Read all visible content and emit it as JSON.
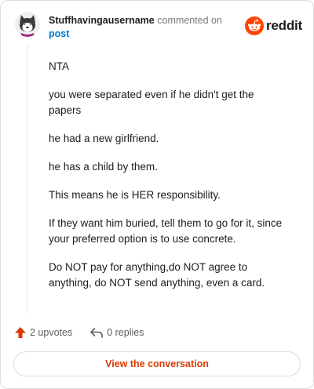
{
  "header": {
    "username": "Stuffhavingausername",
    "action_text": "commented on",
    "post_link": "post",
    "brand": "reddit"
  },
  "comment": {
    "paragraphs": [
      "NTA",
      "you were separated even if he didn't get the papers",
      "he had a new girlfriend.",
      "he has a child by them.",
      "This means he is HER responsibility.",
      "If they want him buried, tell them to go for it, since your preferred option is to use concrete.",
      "Do NOT pay for anything,do NOT agree to anything, do NOT send anything, even a card."
    ]
  },
  "actions": {
    "upvotes": "2 upvotes",
    "replies": "0 replies"
  },
  "footer": {
    "view_button": "View the conversation"
  },
  "colors": {
    "upvote": "#d93a00",
    "reddit_orange": "#ff4500",
    "link": "#0079d3",
    "button_text": "#d93a00"
  },
  "icons": {
    "avatar": "husky-avatar-icon",
    "brand": "reddit-snoo-icon",
    "upvote": "upvote-arrow-icon",
    "reply": "reply-arrow-icon"
  }
}
